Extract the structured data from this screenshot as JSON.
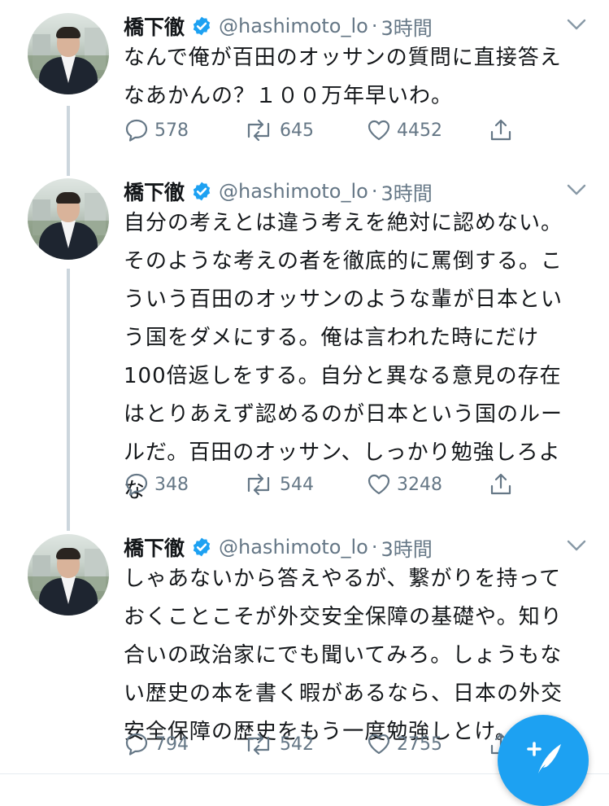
{
  "colors": {
    "accent": "#1da1f2",
    "muted": "#657786",
    "text": "#14171a",
    "thread_line": "#ccd6dd"
  },
  "tweets": [
    {
      "name": "橋下徹",
      "handle": "@hashimoto_lo",
      "separator": "·",
      "time": "3時間",
      "text": "なんで俺が百田のオッサンの質問に直接答え\nなあかんの？１００万年早いわ。",
      "replies": "578",
      "retweets": "645",
      "likes": "4452"
    },
    {
      "name": "橋下徹",
      "handle": "@hashimoto_lo",
      "separator": "·",
      "time": "3時間",
      "text": "自分の考えとは違う考えを絶対に認めない。\nそのような考えの者を徹底的に罵倒する。こ\nういう百田のオッサンのような輩が日本とい\nう国をダメにする。俺は言われた時にだけ\n100倍返しをする。自分と異なる意見の存在\nはとりあえず認めるのが日本という国のルー\nルだ。百田のオッサン、しっかり勉強しろよ\nな",
      "replies": "348",
      "retweets": "544",
      "likes": "3248"
    },
    {
      "name": "橋下徹",
      "handle": "@hashimoto_lo",
      "separator": "·",
      "time": "3時間",
      "text": "しゃあないから答えやるが、繋がりを持って\nおくことこそが外交安全保障の基礎や。知り\n合いの政治家にでも聞いてみろ。しょうもな\nい歴史の本を書く暇があるなら、日本の外交\n安全保障の歴史をもう一度勉強しとけ。",
      "replies": "794",
      "retweets": "542",
      "likes": "2755"
    }
  ],
  "icons": {
    "verified": "verified-badge-icon",
    "chevron": "chevron-down-icon",
    "reply": "reply-icon",
    "retweet": "retweet-icon",
    "like": "heart-icon",
    "share": "share-icon",
    "compose": "compose-tweet-icon"
  }
}
